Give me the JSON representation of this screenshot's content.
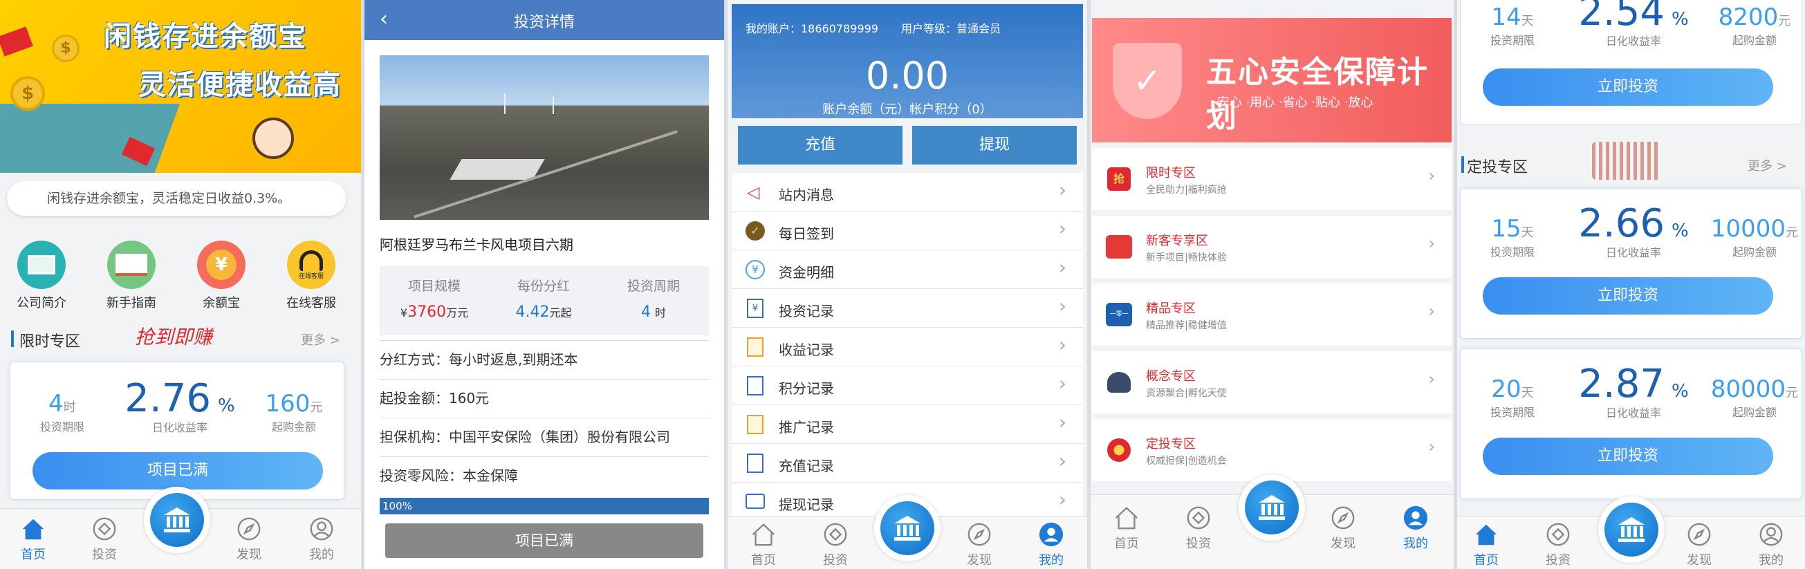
{
  "p1": {
    "banner_line1": "闲钱存进余额宝",
    "banner_line2": "灵活便捷收益高",
    "notice": "闲钱存进余额宝，灵活稳定日收益0.3%。",
    "shortcuts": [
      "公司简介",
      "新手指南",
      "余额宝",
      "在线客服"
    ],
    "headset_caption": "在线客服",
    "section_title": "限时专区",
    "section_slogan": "抢到即赚",
    "more": "更多 >",
    "card": {
      "period": "4",
      "period_unit": "时",
      "period_label": "投资期限",
      "rate": "2.76",
      "rate_unit": "%",
      "rate_label": "日化收益率",
      "min": "160",
      "min_unit": "元",
      "min_label": "起购金额",
      "button": "项目已满"
    }
  },
  "p2": {
    "header": "投资详情",
    "project_title": "阿根廷罗马布兰卡风电项目六期",
    "stats_labels": [
      "项目规模",
      "每份分红",
      "投资周期"
    ],
    "scale_prefix": "¥",
    "scale_value": "3760",
    "scale_unit": "万元",
    "dividend_value": "4.42",
    "dividend_unit": "元起",
    "cycle_value": "4",
    "cycle_unit": "时",
    "rows": [
      "分红方式：每小时返息,到期还本",
      "起投金额：160元",
      "担保机构：中国平安保险（集团）股份有限公司",
      "投资零风险：本金保障"
    ],
    "progress_label": "100%",
    "progress": 100,
    "button": "项目已满"
  },
  "p3": {
    "account": "我的账户：18660789999",
    "level": "用户等级：普通会员",
    "balance": "0.00",
    "balance_caption": "账户余额（元）帐户积分（0）",
    "recharge": "充值",
    "withdraw": "提现",
    "menu": [
      "站内消息",
      "每日签到",
      "资金明细",
      "投资记录",
      "收益记录",
      "积分记录",
      "推广记录",
      "充值记录",
      "提现记录"
    ]
  },
  "p4": {
    "banner_title": "五心安全保障计划",
    "banner_sub": "·安心 ·用心 ·省心 ·贴心 ·放心",
    "items": [
      {
        "title": "限时专区",
        "desc": "全民助力|福利疯抢",
        "icon_text": "抢"
      },
      {
        "title": "新客专享区",
        "desc": "新手项目|畅快体验",
        "icon_text": ""
      },
      {
        "title": "精品专区",
        "desc": "精品推荐|稳健增值",
        "icon_text": "一零一"
      },
      {
        "title": "概念专区",
        "desc": "资源聚合|孵化天使",
        "icon_text": ""
      },
      {
        "title": "定投专区",
        "desc": "权威担保|创造机会",
        "icon_text": ""
      }
    ]
  },
  "p5": {
    "top": {
      "period": "14",
      "rate": "2.54",
      "min": "8200"
    },
    "section_title": "定投专区",
    "more": "更多 >",
    "cards": [
      {
        "period": "15",
        "rate": "2.66",
        "min": "10000"
      },
      {
        "period": "20",
        "rate": "2.87",
        "min": "80000"
      }
    ],
    "period_unit": "天",
    "rate_unit": "%",
    "min_unit": "元",
    "period_label": "投资期限",
    "rate_label": "日化收益率",
    "min_label": "起购金额",
    "button": "立即投资"
  },
  "tabs": {
    "home": "首页",
    "invest": "投资",
    "discover": "发现",
    "mine": "我的"
  },
  "colors": {
    "primary": "#1f7bd6",
    "button_blue": "#3a9ef0",
    "header_blue": "#4a7cc4",
    "red": "#e0282e"
  }
}
